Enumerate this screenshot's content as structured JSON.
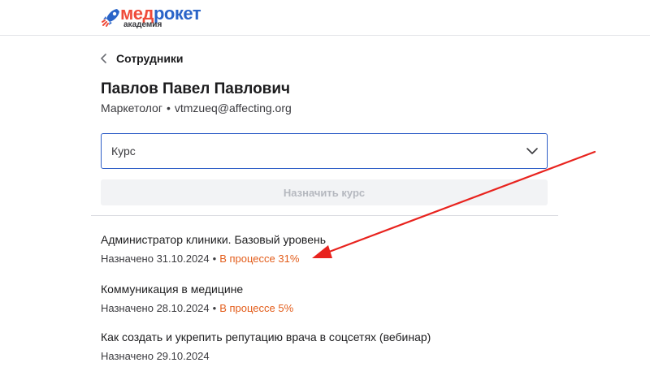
{
  "brand": {
    "logo_part1": "мед",
    "logo_part2": "рокет",
    "logo_sub": "академия",
    "colors": {
      "red": "#ef4b3a",
      "blue": "#2a64c8"
    }
  },
  "nav": {
    "back_label": "Сотрудники",
    "back_icon": "chevron-left-icon"
  },
  "employee": {
    "full_name": "Павлов Павел Павлович",
    "role": "Маркетолог",
    "separator": "•",
    "email": "vtmzueq@affecting.org"
  },
  "course_select": {
    "value": "Курс",
    "icon": "chevron-down-icon"
  },
  "assign_button": {
    "label": "Назначить курс",
    "enabled": false
  },
  "courses": [
    {
      "title": "Администратор клиники. Базовый уровень",
      "assigned": "Назначено 31.10.2024",
      "status": "В процессе 31%",
      "progress_percent": 31
    },
    {
      "title": "Коммуникация в медицине",
      "assigned": "Назначено 28.10.2024",
      "status": "В процессе 5%",
      "progress_percent": 5
    },
    {
      "title": "Как создать и укрепить репутацию врача в соцсетях (вебинар)",
      "assigned": "Назначено 29.10.2024",
      "status": ""
    }
  ],
  "annotation": {
    "icon": "red-arrow-icon",
    "color": "#e8231e"
  },
  "colors": {
    "accent_blue": "#2f5fc7",
    "status_orange": "#e35d1b",
    "disabled_text": "#b5b8bf"
  }
}
